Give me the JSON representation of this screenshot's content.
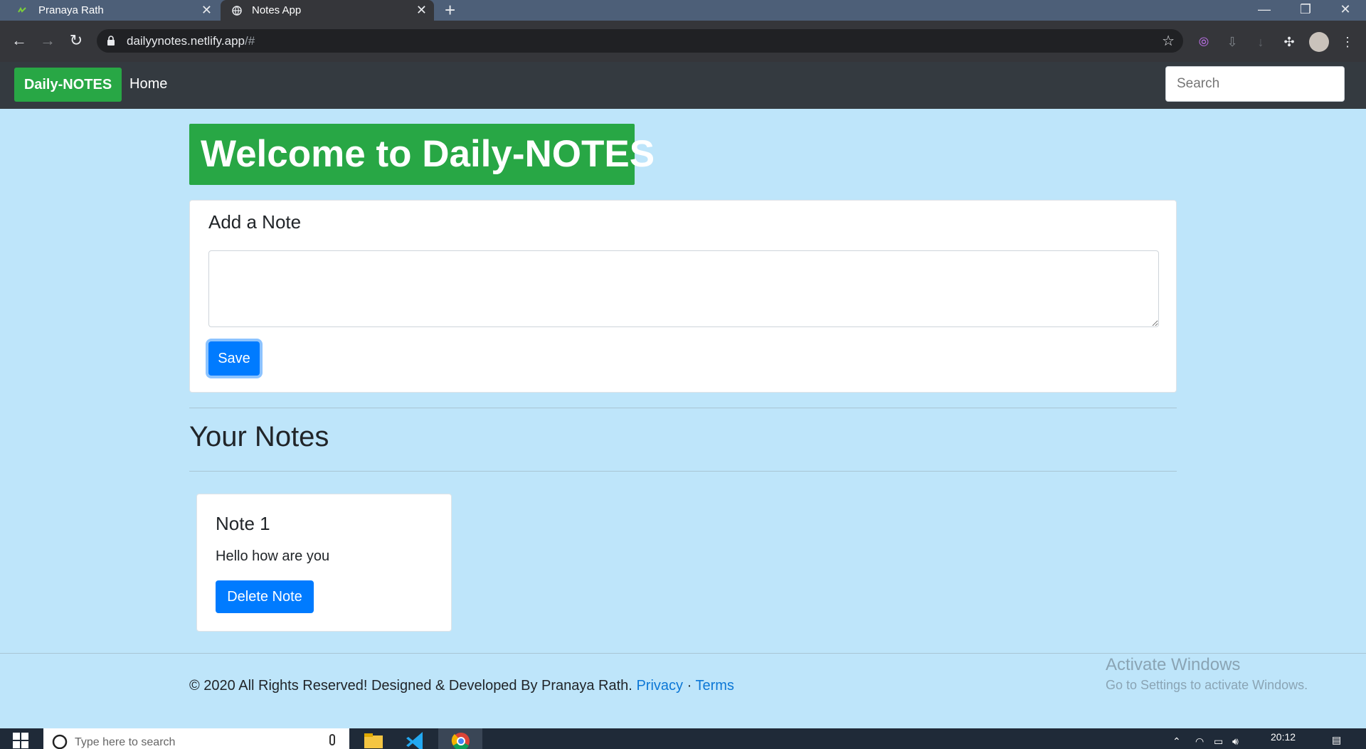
{
  "browser": {
    "tabs": [
      {
        "label": "Pranaya Rath",
        "active": false
      },
      {
        "label": "Notes App",
        "active": true
      }
    ],
    "url_host": "dailyynotes.netlify.app",
    "url_path": "/#"
  },
  "navbar": {
    "brand": "Daily-NOTES",
    "home": "Home",
    "search_placeholder": "Search"
  },
  "hero": {
    "title": "Welcome to Daily-NOTES"
  },
  "add_note": {
    "heading": "Add a Note",
    "textarea_value": "",
    "save_label": "Save"
  },
  "notes_section": {
    "heading": "Your Notes"
  },
  "notes": [
    {
      "title": "Note 1",
      "body": "Hello how are you",
      "delete_label": "Delete Note"
    }
  ],
  "footer": {
    "text": "© 2020 All Rights Reserved! Designed & Developed By Pranaya Rath.",
    "privacy": "Privacy",
    "sep": "·",
    "terms": "Terms"
  },
  "watermark": {
    "line1": "Activate Windows",
    "line2": "Go to Settings to activate Windows."
  },
  "taskbar": {
    "search_placeholder": "Type here to search",
    "time": "20:12"
  },
  "colors": {
    "page_bg": "#bee5fa",
    "brand_green": "#28a745",
    "primary_blue": "#007bff",
    "navbar_dark": "#343a40"
  }
}
